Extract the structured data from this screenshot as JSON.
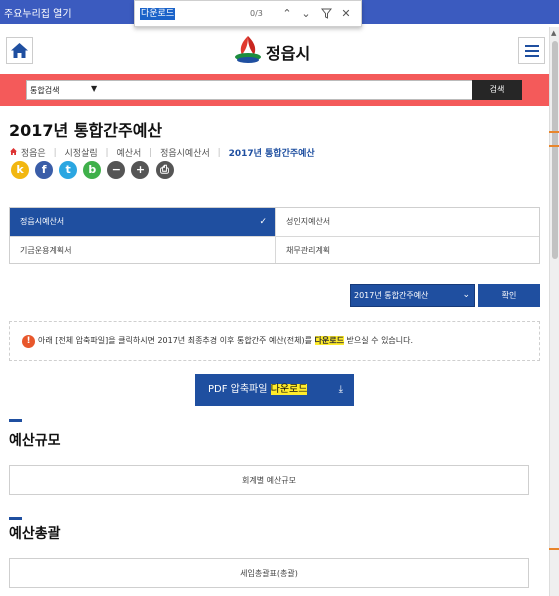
{
  "window": {
    "title": "주요누리집 열기"
  },
  "find": {
    "query": "다운로드",
    "count": "0/3",
    "up_icon": "chevron-up-icon",
    "down_icon": "chevron-down-icon",
    "filter_icon": "filter-icon",
    "close_icon": "close-icon"
  },
  "header": {
    "logo_text": "정읍시",
    "home_icon": "home-icon",
    "menu_icon": "hamburger-menu-icon"
  },
  "search": {
    "category": "통합검색",
    "button": "검색",
    "band_color": "#f45a5a"
  },
  "page": {
    "title": "2017년 통합간주예산",
    "breadcrumb": [
      "정읍은",
      "시정살림",
      "예산서",
      "정읍시예산서",
      "2017년 통합간주예산"
    ]
  },
  "social": [
    {
      "icon": "kakaostory-icon",
      "glyph": "k",
      "color": "#f2b711"
    },
    {
      "icon": "facebook-icon",
      "glyph": "f",
      "color": "#3a5da8"
    },
    {
      "icon": "twitter-icon",
      "glyph": "t",
      "color": "#2ba6e1"
    },
    {
      "icon": "band-icon",
      "glyph": "b",
      "color": "#3fb04a"
    },
    {
      "icon": "zoom-out-icon",
      "glyph": "−",
      "color": "#555555"
    },
    {
      "icon": "zoom-in-icon",
      "glyph": "+",
      "color": "#555555"
    },
    {
      "icon": "print-icon",
      "glyph": "⎙",
      "color": "#555555"
    }
  ],
  "tabs": [
    {
      "label": "정읍시예산서",
      "active": true
    },
    {
      "label": "성인지예산서",
      "active": false
    },
    {
      "label": "기금운용계획서",
      "active": false
    },
    {
      "label": "채무관리계획",
      "active": false
    }
  ],
  "year_select": {
    "selected": "2017년 통합간주예산",
    "confirm": "확인"
  },
  "notice": {
    "before": "아래 [전체 압축파일]을 클릭하시면 2017년 최종추경 이후 통합간주 예산(전체)를",
    "highlight": "다운로드",
    "after": " 받으실 수 있습니다."
  },
  "pdf": {
    "before": "PDF 압축파일 ",
    "highlight": "다운로드",
    "icon": "download-icon"
  },
  "sections": [
    {
      "heading": "예산규모",
      "box": "회계별 예산규모"
    },
    {
      "heading": "예산총괄",
      "box": "세입총괄표(총괄)"
    }
  ],
  "colors": {
    "primary": "#1f4fa0",
    "highlight": "#ffec2b",
    "notice_icon": "#e8572b"
  }
}
